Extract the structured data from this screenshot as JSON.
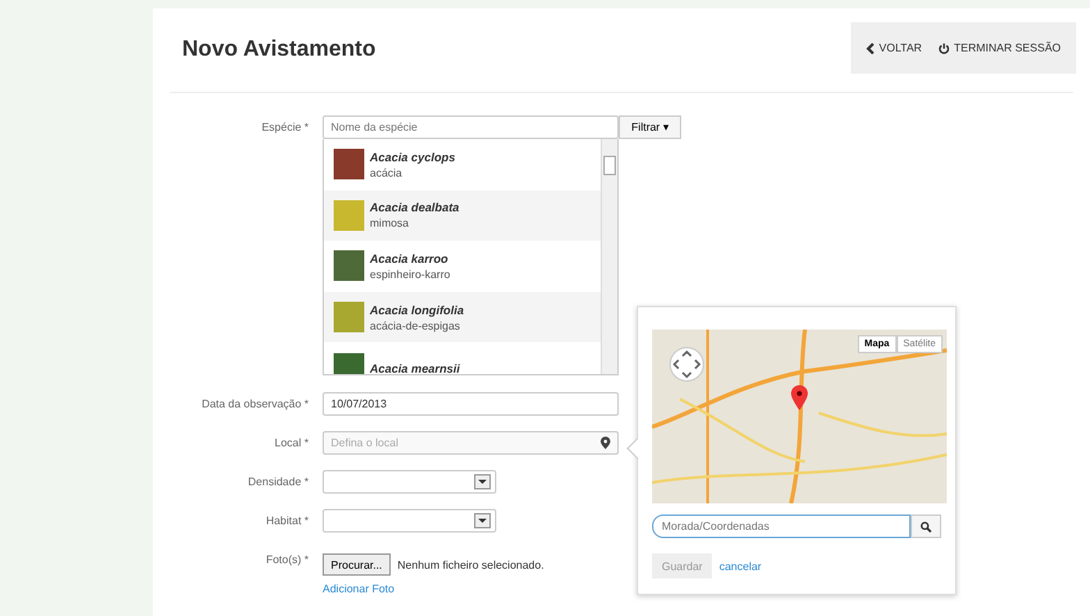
{
  "header": {
    "title": "Novo Avistamento",
    "actions": [
      {
        "label": "VOLTAR"
      },
      {
        "label": "TERMINAR SESSÃO"
      }
    ]
  },
  "species": {
    "label": "Espécie *",
    "placeholder": "Nome da espécie",
    "filter_button": "Filtrar ▾",
    "results": [
      {
        "name": "Acacia cyclops",
        "common": "acácia",
        "color": "#8a3a2a"
      },
      {
        "name": "Acacia dealbata",
        "common": "mimosa",
        "color": "#c8b830"
      },
      {
        "name": "Acacia karroo",
        "common": "espinheiro-karro",
        "color": "#4e6a38"
      },
      {
        "name": "Acacia longifolia",
        "common": "acácia-de-espigas",
        "color": "#a8a830"
      },
      {
        "name": "Acacia mearnsii",
        "color": "#3a6a30"
      }
    ]
  },
  "fields": [
    {
      "kind": "text",
      "label": "Data da observação *",
      "value": "10/07/2013"
    },
    {
      "kind": "location",
      "label": "Local *",
      "placeholder": "Defina o local"
    },
    {
      "kind": "select",
      "label": "Densidade *"
    },
    {
      "kind": "select",
      "label": "Habitat *"
    },
    {
      "kind": "file",
      "label": "Foto(s) *",
      "button": "Procurar...",
      "status": "Nenhum ficheiro selecionado.",
      "link": "Adicionar Foto"
    }
  ],
  "map_popover": {
    "map_types": [
      {
        "label": "Mapa",
        "selected": true
      },
      {
        "label": "Satélite",
        "selected": false
      }
    ],
    "search_placeholder": "Morada/Coordenadas",
    "save_button": "Guardar",
    "cancel_link": "cancelar"
  }
}
